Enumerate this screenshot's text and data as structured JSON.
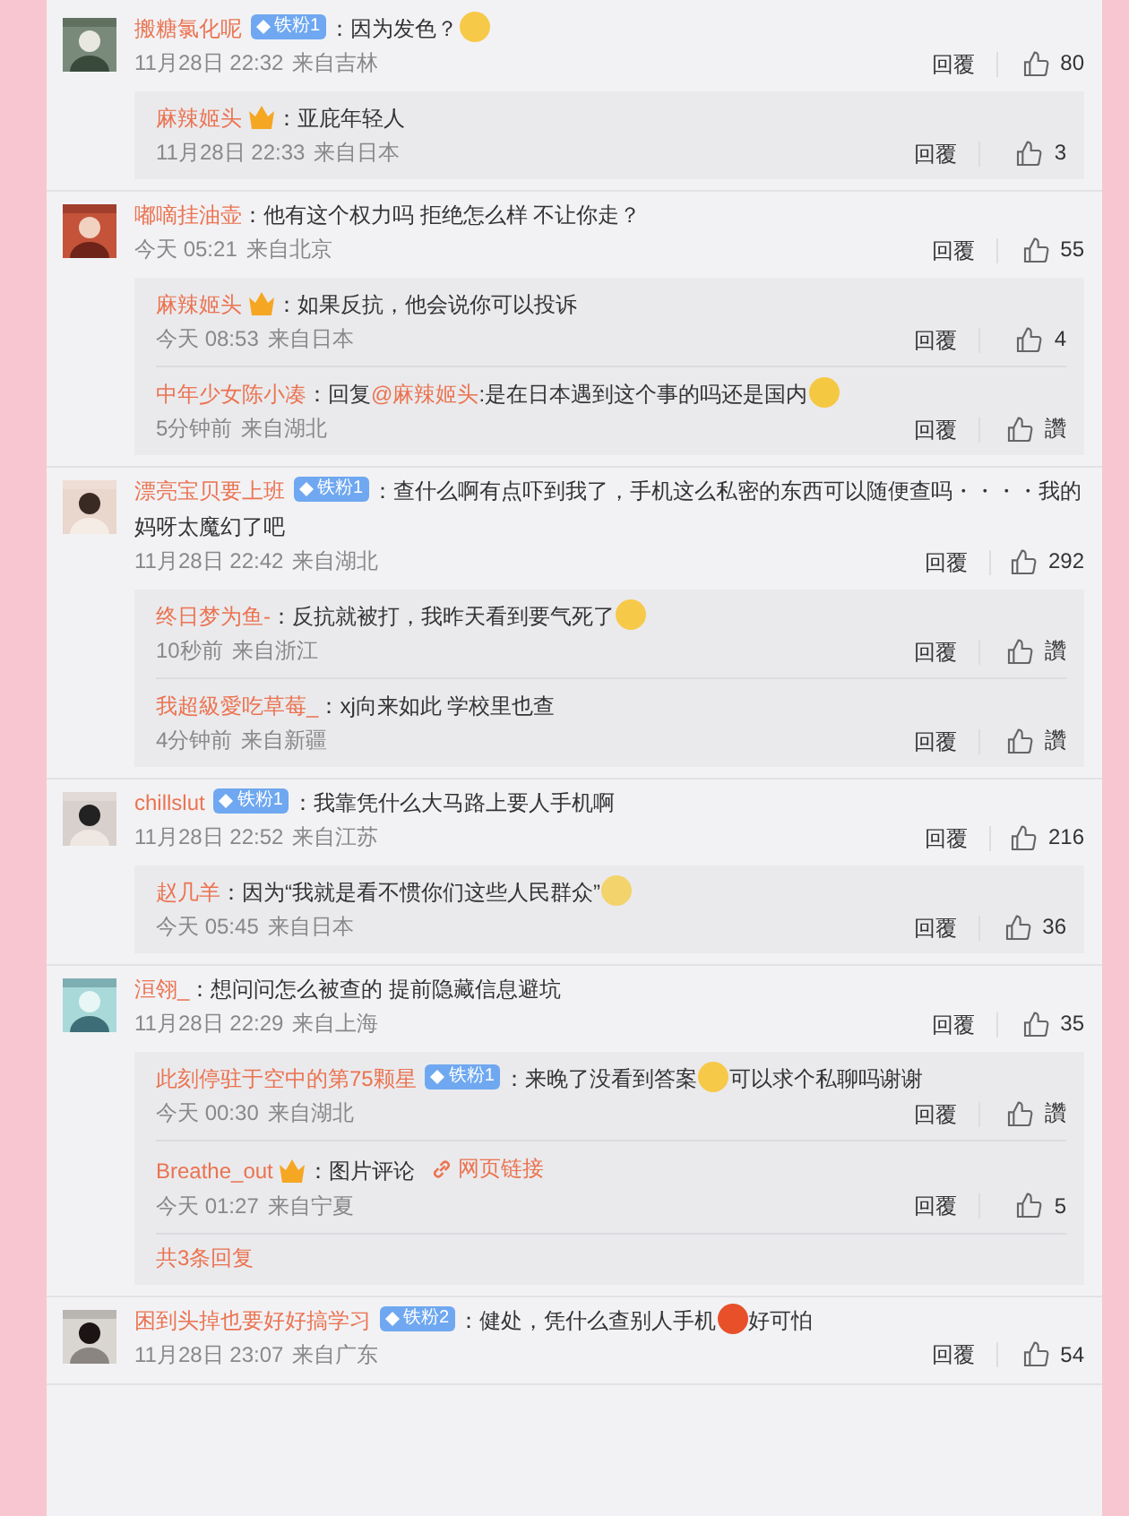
{
  "comments": [
    {
      "name": "搬糖氯化呢",
      "badge": "铁粉1",
      "content": [
        {
          "kind": "text",
          "text": "：因为发色？"
        },
        {
          "kind": "emoji",
          "color": "#f7c948"
        }
      ],
      "time": "11月28日 22:32",
      "location": "来自吉林",
      "reply_label": "回覆",
      "likes": "80",
      "replies": [
        {
          "name": "麻辣姬头",
          "vip": true,
          "content": [
            {
              "kind": "text",
              "text": "：亚庇年轻人"
            }
          ],
          "time": "11月28日 22:33",
          "location": "来自日本",
          "reply_label": "回覆",
          "likes": "3"
        }
      ]
    },
    {
      "name": "嘟嘀挂油壶",
      "content": [
        {
          "kind": "text",
          "text": "：他有这个权力吗 拒绝怎么样 不让你走？"
        }
      ],
      "time": "今天 05:21",
      "location": "来自北京",
      "reply_label": "回覆",
      "likes": "55",
      "replies": [
        {
          "name": "麻辣姬头",
          "vip": true,
          "content": [
            {
              "kind": "text",
              "text": "：如果反抗，他会说你可以投诉"
            }
          ],
          "time": "今天 08:53",
          "location": "来自日本",
          "reply_label": "回覆",
          "likes": "4"
        },
        {
          "name": "中年少女陈小凑",
          "vip": false,
          "content": [
            {
              "kind": "text",
              "text": "：回复"
            },
            {
              "kind": "mention",
              "text": "@麻辣姬头"
            },
            {
              "kind": "text",
              "text": ":是在日本遇到这个事的吗还是国内"
            },
            {
              "kind": "emoji",
              "color": "#f5c842"
            }
          ],
          "time": "5分钟前",
          "location": "来自湖北",
          "reply_label": "回覆",
          "likes": "讚"
        }
      ]
    },
    {
      "name": "漂亮宝贝要上班",
      "badge": "铁粉1",
      "content": [
        {
          "kind": "text",
          "text": "：查什么啊有点吓到我了，手机这么私密的东西可以随便查吗・・・・我的"
        },
        {
          "kind": "text",
          "text": "妈呀太魔幻了吧"
        }
      ],
      "time": "11月28日 22:42",
      "location": "来自湖北",
      "reply_label": "回覆",
      "likes": "292",
      "replies": [
        {
          "name": "终日梦为鱼-",
          "vip": false,
          "content": [
            {
              "kind": "text",
              "text": "：反抗就被打，我昨天看到要气死了"
            },
            {
              "kind": "emoji",
              "color": "#f7c948"
            }
          ],
          "time": "10秒前",
          "location": "来自浙江",
          "reply_label": "回覆",
          "likes": "讚"
        },
        {
          "name": "我超級愛吃草莓_",
          "vip": false,
          "content": [
            {
              "kind": "text",
              "text": "：xj向来如此 学校里也查"
            }
          ],
          "time": "4分钟前",
          "location": "来自新疆",
          "reply_label": "回覆",
          "likes": "讚"
        }
      ]
    },
    {
      "name": "chillslut",
      "badge": "铁粉1",
      "content": [
        {
          "kind": "text",
          "text": "：我靠凭什么大马路上要人手机啊"
        }
      ],
      "time": "11月28日 22:52",
      "location": "来自江苏",
      "reply_label": "回覆",
      "likes": "216",
      "replies": [
        {
          "name": "赵几羊",
          "vip": false,
          "content": [
            {
              "kind": "text",
              "text": "：因为“我就是看不惯你们这些人民群众”"
            },
            {
              "kind": "emoji",
              "color": "#f3d36b"
            }
          ],
          "time": "今天 05:45",
          "location": "来自日本",
          "reply_label": "回覆",
          "likes": "36"
        }
      ]
    },
    {
      "name": "洹翎_",
      "content": [
        {
          "kind": "text",
          "text": "：想问问怎么被查的 提前隐藏信息避坑"
        }
      ],
      "time": "11月28日 22:29",
      "location": "来自上海",
      "reply_label": "回覆",
      "likes": "35",
      "replies": [
        {
          "name": "此刻停驻于空中的第75颗星",
          "badge": "铁粉1",
          "vip": false,
          "content": [
            {
              "kind": "text",
              "text": "：来晚了没看到答案"
            },
            {
              "kind": "emoji",
              "color": "#f7c948"
            },
            {
              "kind": "text",
              "text": "可以求个私聊吗谢谢"
            }
          ],
          "time": "今天 00:30",
          "location": "来自湖北",
          "reply_label": "回覆",
          "likes": "讚"
        },
        {
          "name": "Breathe_out",
          "vip": true,
          "content": [
            {
              "kind": "text",
              "text": "：图片评论"
            },
            {
              "kind": "link",
              "text": "网页链接"
            }
          ],
          "time": "今天 01:27",
          "location": "来自宁夏",
          "reply_label": "回覆",
          "likes": "5"
        }
      ],
      "more_replies": "共3条回复"
    },
    {
      "name": "困到头掉也要好好搞学习",
      "badge": "铁粉2",
      "content": [
        {
          "kind": "text",
          "text": "：健处，凭什么查别人手机"
        },
        {
          "kind": "emoji",
          "color": "#e8502a"
        },
        {
          "kind": "text",
          "text": "好可怕"
        }
      ],
      "time": "11月28日 23:07",
      "location": "来自广东",
      "reply_label": "回覆",
      "likes": "54"
    }
  ]
}
